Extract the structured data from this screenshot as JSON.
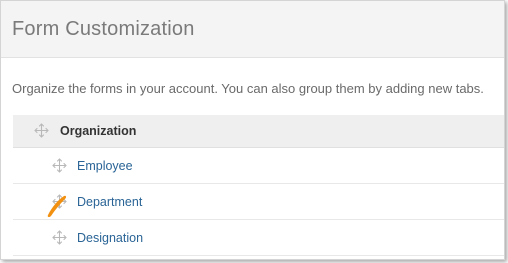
{
  "header": {
    "title": "Form Customization"
  },
  "description": "Organize the forms in your account. You can also group them by adding new tabs.",
  "group": {
    "label": "Organization",
    "items": [
      {
        "label": "Employee"
      },
      {
        "label": "Department"
      },
      {
        "label": "Designation"
      }
    ]
  },
  "icons": {
    "drag_handle": "move-arrows-icon",
    "pointer": "orange-click-indicator-icon"
  },
  "colors": {
    "link": "#2a6496",
    "header_bg": "#f4f4f4",
    "group_bg": "#efefef",
    "accent": "#f29111"
  }
}
